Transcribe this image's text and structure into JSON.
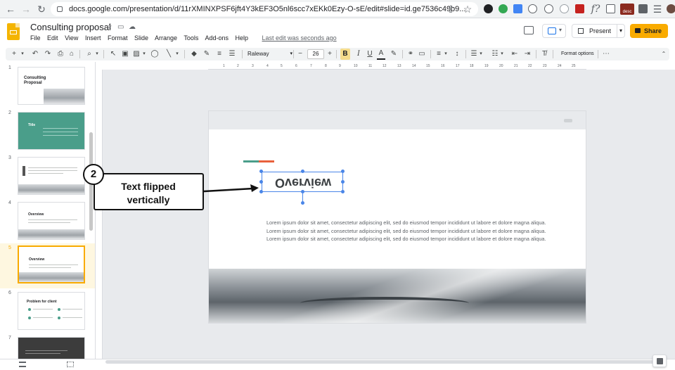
{
  "browser": {
    "url": "docs.google.com/presentation/d/11rXMINXPSF6jft4Y3kEF3O5nl6scc7xEKk0Ezy-O-sE/edit#slide=id.ge7536c49b9...",
    "back_icon": "arrow-left",
    "forward_icon": "arrow-right",
    "reload_icon": "reload",
    "star_icon": "star",
    "ext_badge": "desc"
  },
  "docs": {
    "title": "Consulting proposal",
    "menu": [
      "File",
      "Edit",
      "View",
      "Insert",
      "Format",
      "Slide",
      "Arrange",
      "Tools",
      "Add-ons",
      "Help"
    ],
    "last_edit": "Last edit was seconds ago",
    "present_label": "Present",
    "share_label": "Share"
  },
  "toolbar": {
    "font": "Raleway",
    "font_size": "26",
    "bold_label": "B",
    "text_color_label": "A",
    "format_options": "Format options",
    "more_label": "⋯"
  },
  "ruler": {
    "marks": [
      "1",
      "2",
      "3",
      "4",
      "5",
      "6",
      "7",
      "8",
      "9",
      "10",
      "11",
      "12",
      "13",
      "14",
      "15",
      "16",
      "17",
      "18",
      "19",
      "20",
      "21",
      "22",
      "23",
      "24",
      "25"
    ]
  },
  "filmstrip": {
    "slides": [
      {
        "num": "1",
        "title": "Consulting Proposal"
      },
      {
        "num": "2",
        "title": "Title"
      },
      {
        "num": "3",
        "title": ""
      },
      {
        "num": "4",
        "title": "Overview"
      },
      {
        "num": "5",
        "title": "Overview",
        "active": true
      },
      {
        "num": "6",
        "title": "Problem for client"
      },
      {
        "num": "7",
        "title": ""
      }
    ]
  },
  "slide": {
    "title": "Overview",
    "title_flipped": true,
    "body": "Lorem ipsum dolor sit amet, consectetur adipiscing elit, sed do eiusmod tempor incididunt ut labore et dolore magna aliqua. Lorem ipsum dolor sit amet, consectetur adipiscing elit, sed do eiusmod tempor incididunt ut labore et dolore magna aliqua. Lorem ipsum dolor sit amet, consectetur adipiscing elit, sed do eiusmod tempor incididunt ut labore et dolore magna aliqua.",
    "accent_colors": [
      "#4a9e8a",
      "#e8613c"
    ]
  },
  "callout": {
    "number": "2",
    "line1": "Text flipped",
    "line2": "vertically"
  },
  "colors": {
    "share": "#f9ab00",
    "selection": "#4a86e8",
    "active_slide_border": "#f9ab00"
  }
}
